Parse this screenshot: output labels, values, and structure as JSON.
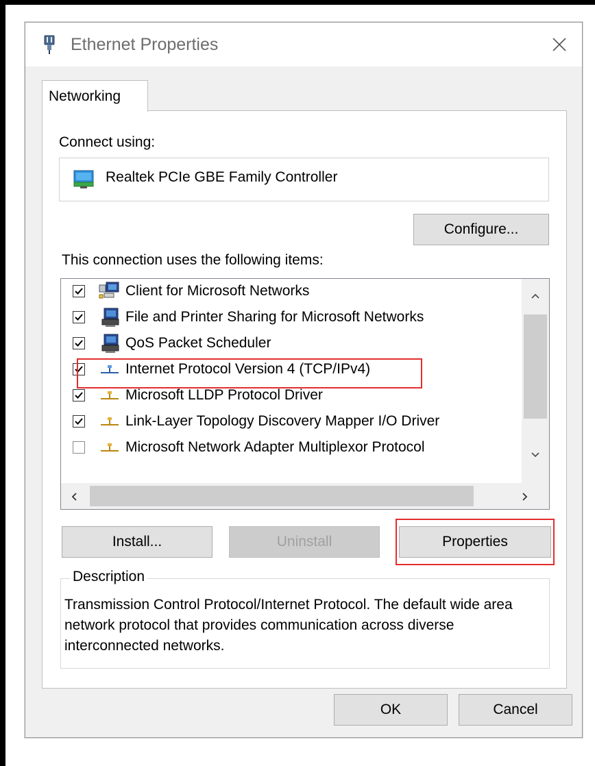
{
  "window": {
    "title": "Ethernet Properties",
    "icon": "network-adapter-icon",
    "close_icon": "close-icon"
  },
  "tabs": [
    {
      "label": "Networking",
      "selected": true
    }
  ],
  "connect_using": {
    "label": "Connect using:",
    "adapter_name": "Realtek PCIe GBE Family Controller",
    "adapter_icon": "network-card-icon",
    "configure_label": "Configure..."
  },
  "items_section": {
    "label": "This connection uses the following items:",
    "items": [
      {
        "label": "Client for Microsoft Networks",
        "checked": true,
        "icon": "network-client-icon"
      },
      {
        "label": "File and Printer Sharing for Microsoft Networks",
        "checked": true,
        "icon": "network-service-icon"
      },
      {
        "label": "QoS Packet Scheduler",
        "checked": true,
        "icon": "network-service-icon"
      },
      {
        "label": "Internet Protocol Version 4 (TCP/IPv4)",
        "checked": true,
        "icon": "network-protocol-icon",
        "highlighted": true,
        "selected": true
      },
      {
        "label": "Microsoft LLDP Protocol Driver",
        "checked": true,
        "icon": "network-protocol-icon"
      },
      {
        "label": "Link-Layer Topology Discovery Mapper I/O Driver",
        "checked": true,
        "icon": "network-protocol-icon"
      },
      {
        "label": "Microsoft Network Adapter Multiplexor Protocol",
        "checked": false,
        "icon": "network-protocol-icon"
      }
    ]
  },
  "buttons": {
    "install": "Install...",
    "uninstall": "Uninstall",
    "uninstall_enabled": false,
    "properties": "Properties",
    "ok": "OK",
    "cancel": "Cancel"
  },
  "description": {
    "title": "Description",
    "text": "Transmission Control Protocol/Internet Protocol. The default wide area network protocol that provides communication across diverse interconnected networks."
  },
  "colors": {
    "highlight": "#e32d2d",
    "dialog_bg": "#f0f0f0",
    "panel_bg": "#ffffff"
  }
}
